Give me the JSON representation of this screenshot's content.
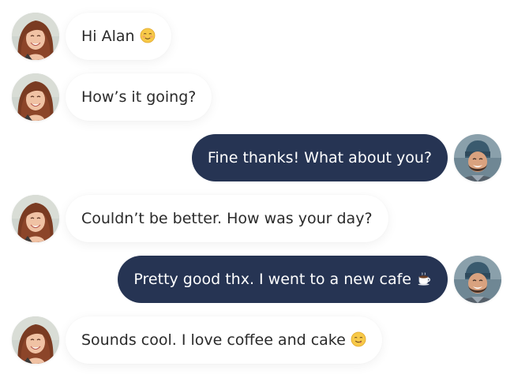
{
  "conversation": {
    "messages": [
      {
        "from": "her",
        "text": "Hi Alan",
        "emoji": "smiling-blush-emoji"
      },
      {
        "from": "her",
        "text": "How’s it going?",
        "emoji": ""
      },
      {
        "from": "him",
        "text": "Fine thanks! What about you?",
        "emoji": ""
      },
      {
        "from": "her",
        "text": "Couldn’t be better. How was your day?",
        "emoji": ""
      },
      {
        "from": "him",
        "text": "Pretty good thx. I went to a new cafe",
        "emoji": "coffee-cup-emoji"
      },
      {
        "from": "her",
        "text": "Sounds cool. I love coffee and cake",
        "emoji": "savoring-food-emoji"
      }
    ]
  },
  "colors": {
    "incoming_bubble": "#ffffff",
    "outgoing_bubble": "#263453",
    "incoming_text": "#2a2a2a",
    "outgoing_text": "#ffffff"
  },
  "icons": {
    "female_avatar": "woman-avatar",
    "male_avatar": "man-avatar"
  }
}
